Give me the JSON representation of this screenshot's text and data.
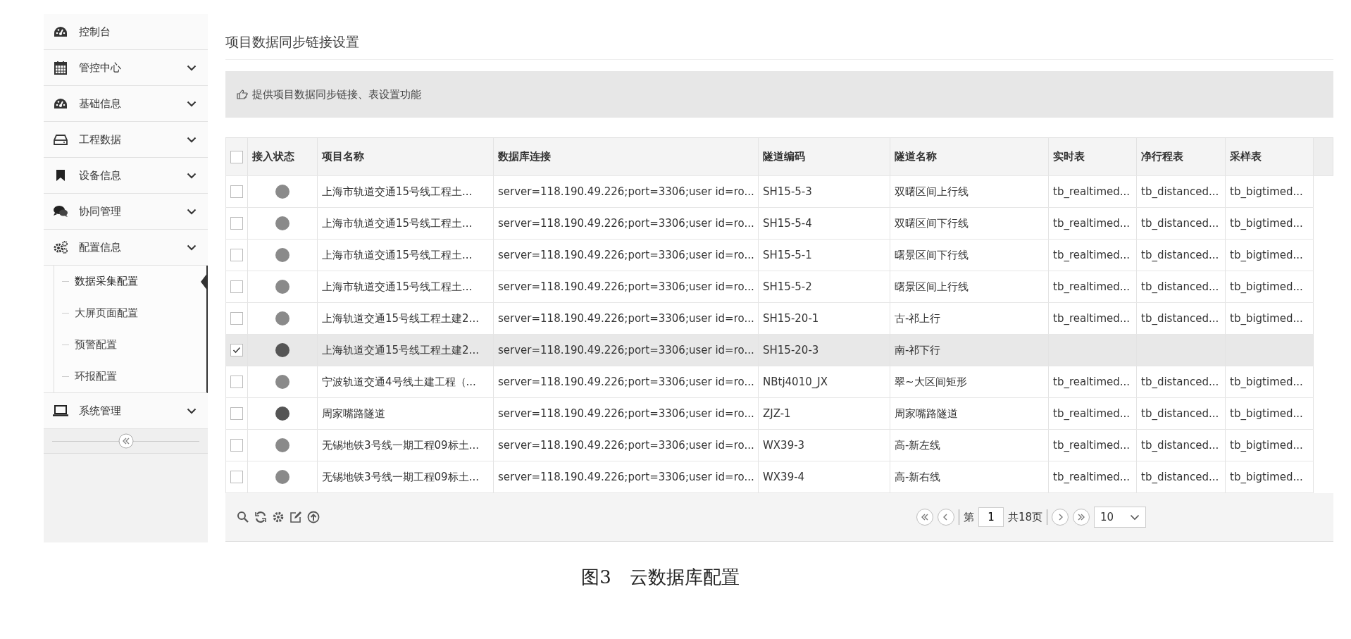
{
  "sidebar": {
    "items": [
      {
        "kind": "link",
        "label": "控制台"
      },
      {
        "kind": "menu",
        "label": "管控中心"
      },
      {
        "kind": "menu",
        "label": "基础信息"
      },
      {
        "kind": "menu",
        "label": "工程数据"
      },
      {
        "kind": "menu",
        "label": "设备信息"
      },
      {
        "kind": "menu",
        "label": "协同管理"
      },
      {
        "kind": "menu",
        "label": "配置信息",
        "children": [
          {
            "label": "数据采集配置",
            "selected": true
          },
          {
            "label": "大屏页面配置",
            "selected": false
          },
          {
            "label": "预警配置",
            "selected": false
          },
          {
            "label": "环报配置",
            "selected": false
          }
        ]
      },
      {
        "kind": "menu",
        "label": "系统管理"
      }
    ]
  },
  "page": {
    "title": "项目数据同步链接设置",
    "info": "提供项目数据同步链接、表设置功能"
  },
  "table": {
    "select_all": false,
    "columns": [
      "接入状态",
      "项目名称",
      "数据库连接",
      "隧道编码",
      "隧道名称",
      "实时表",
      "净行程表",
      "采样表"
    ],
    "rows": [
      {
        "selected": false,
        "color": "#8a8a8a",
        "project": "上海市轨道交通15号线工程土...",
        "db": "server=118.190.49.226;port=3306;user id=ro...",
        "code": "SH15-5-3",
        "tunnel": "双曙区间上行线",
        "realtime": "tb_realtimed...",
        "distance": "tb_distanced...",
        "sample": "tb_bigtimed..."
      },
      {
        "selected": false,
        "color": "#8a8a8a",
        "project": "上海市轨道交通15号线工程土...",
        "db": "server=118.190.49.226;port=3306;user id=ro...",
        "code": "SH15-5-4",
        "tunnel": "双曙区间下行线",
        "realtime": "tb_realtimed...",
        "distance": "tb_distanced...",
        "sample": "tb_bigtimed..."
      },
      {
        "selected": false,
        "color": "#8a8a8a",
        "project": "上海市轨道交通15号线工程土...",
        "db": "server=118.190.49.226;port=3306;user id=ro...",
        "code": "SH15-5-1",
        "tunnel": "曙景区间下行线",
        "realtime": "tb_realtimed...",
        "distance": "tb_distanced...",
        "sample": "tb_bigtimed..."
      },
      {
        "selected": false,
        "color": "#8a8a8a",
        "project": "上海市轨道交通15号线工程土...",
        "db": "server=118.190.49.226;port=3306;user id=ro...",
        "code": "SH15-5-2",
        "tunnel": "曙景区间上行线",
        "realtime": "tb_realtimed...",
        "distance": "tb_distanced...",
        "sample": "tb_bigtimed..."
      },
      {
        "selected": false,
        "color": "#8a8a8a",
        "project": "上海轨道交通15号线工程土建2...",
        "db": "server=118.190.49.226;port=3306;user id=ro...",
        "code": "SH15-20-1",
        "tunnel": "古-祁上行",
        "realtime": "tb_realtimed...",
        "distance": "tb_distanced...",
        "sample": "tb_bigtimed..."
      },
      {
        "selected": true,
        "color": "#555555",
        "project": "上海轨道交通15号线工程土建2...",
        "db": "server=118.190.49.226;port=3306;user id=ro...",
        "code": "SH15-20-3",
        "tunnel": "南-祁下行"
      },
      {
        "selected": false,
        "color": "#8a8a8a",
        "project": "宁波轨道交通4号线土建工程（...",
        "db": "server=118.190.49.226;port=3306;user id=ro...",
        "code": "NBtj4010_JX",
        "tunnel": "翠~大区间矩形",
        "realtime": "tb_realtimed...",
        "distance": "tb_distanced...",
        "sample": "tb_bigtimed..."
      },
      {
        "selected": false,
        "color": "#555555",
        "project": "周家嘴路隧道",
        "db": "server=118.190.49.226;port=3306;user id=ro...",
        "code": "ZJZ-1",
        "tunnel": "周家嘴路隧道",
        "realtime": "tb_realtimed...",
        "distance": "tb_distanced...",
        "sample": "tb_bigtimed..."
      },
      {
        "selected": false,
        "color": "#8a8a8a",
        "project": "无锡地铁3号线一期工程09标土...",
        "db": "server=118.190.49.226;port=3306;user id=ro...",
        "code": "WX39-3",
        "tunnel": "高-新左线",
        "realtime": "tb_realtimed...",
        "distance": "tb_distanced...",
        "sample": "tb_bigtimed..."
      },
      {
        "selected": false,
        "color": "#8a8a8a",
        "project": "无锡地铁3号线一期工程09标土...",
        "db": "server=118.190.49.226;port=3306;user id=ro...",
        "code": "WX39-4",
        "tunnel": "高-新右线",
        "realtime": "tb_realtimed...",
        "distance": "tb_distanced...",
        "sample": "tb_bigtimed..."
      }
    ]
  },
  "pager": {
    "page_prefix": "第",
    "page": "1",
    "total": "共18页",
    "page_size": "10"
  },
  "caption": "图3　云数据库配置"
}
